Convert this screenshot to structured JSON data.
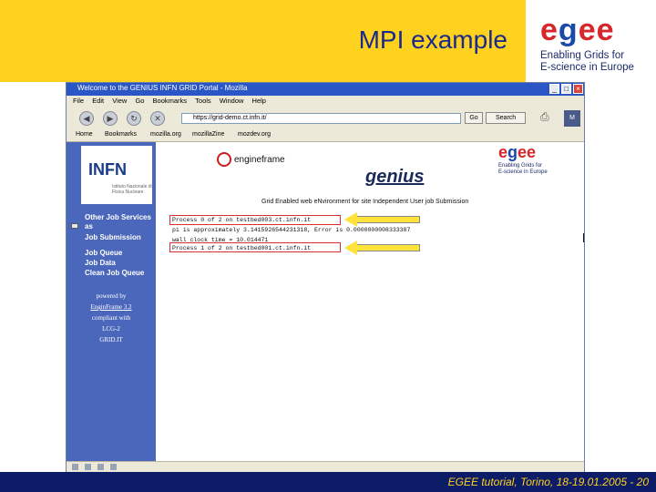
{
  "slide": {
    "title": "MPI example",
    "footer": "EGEE tutorial, Torino, 18-19.01.2005  - 20"
  },
  "logo": {
    "egee_e1": "e",
    "egee_g": "g",
    "egee_e2": "ee",
    "tagline_1": "Enabling Grids for",
    "tagline_2": "E-science in Europe"
  },
  "browser": {
    "title": "Welcome to the GENIUS INFN GRID Portal - Mozilla",
    "menu": [
      "File",
      "Edit",
      "View",
      "Go",
      "Bookmarks",
      "Tools",
      "Window",
      "Help"
    ],
    "url": "https://grid-demo.ct.infn.it/",
    "go_label": "Go",
    "search_label": "Search",
    "bookmarks": [
      "Home",
      "Bookmarks",
      "mozilla.org",
      "mozillaZine",
      "mozdev.org"
    ]
  },
  "left_panel": {
    "infn": "INFN",
    "infn_sub": "Istituto Nazionale di Fisica Nucleare",
    "menu": [
      "Other Job Services",
      "as",
      "Job Submission",
      "Job Queue",
      "Job Data",
      "Clean Job Queue"
    ],
    "powered": [
      "powered by",
      "EnginFrame 3.2",
      "compliant with",
      "LCG-2",
      "GRID.IT"
    ]
  },
  "content": {
    "engframe": "engineframe",
    "genius": "genius",
    "egee_small": "egee",
    "egee_small_tag_1": "Enabling Grids for",
    "egee_small_tag_2": "E-science in Europe",
    "grid_path": "Grid Enabled web eNvironment for site Independent User job Submission",
    "output_lines": [
      "Process 0 of 2 on testbed003.ct.infn.it",
      "pi is approximately 3.1415926544231318, Error is 0.0000000008333387",
      "wall clock time = 10.014471",
      "Process 1 of 2 on testbed001.ct.infn.it"
    ]
  }
}
